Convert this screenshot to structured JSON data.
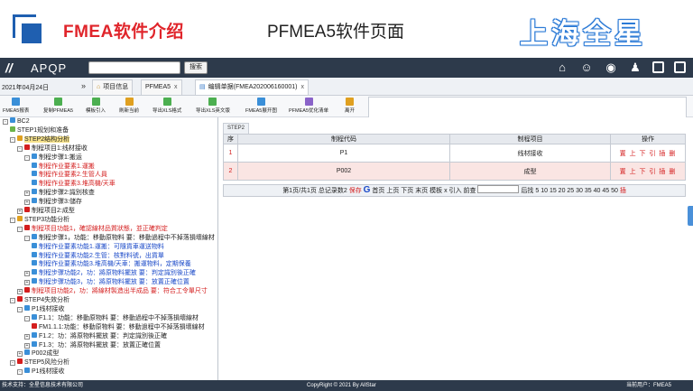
{
  "slide": {
    "title": "FMEA软件介绍",
    "subtitle": "PFMEA5软件页面",
    "brand": "上海全星"
  },
  "app": {
    "name": "APQP",
    "search_placeholder": "",
    "search_button": "搜索",
    "top_icons": [
      "home-icon",
      "users-icon",
      "globe-icon",
      "user-icon",
      "window-icon",
      "close-icon"
    ]
  },
  "tabs": {
    "date": "2021年04月24日",
    "items": [
      {
        "label": "项目信息",
        "closable": false
      },
      {
        "label": "PFMEA5",
        "closable": true
      },
      {
        "label": "编辑单据(FMEA202006160001)",
        "closable": true
      }
    ]
  },
  "toolbar": {
    "items": [
      {
        "label": "FMEA5报表",
        "color": "#3a8fd8"
      },
      {
        "label": "复制PFMEA5",
        "color": "#4caf50"
      },
      {
        "label": "模板引入",
        "color": "#4caf50"
      },
      {
        "label": "刷新当前",
        "color": "#e0a020"
      },
      {
        "label": "导出XLS格式",
        "color": "#4caf50"
      },
      {
        "label": "导出XLS英文版",
        "color": "#4caf50"
      },
      {
        "label": "FMEA5展开图",
        "color": "#3a8fd8"
      },
      {
        "label": "PFMEA5优化清单",
        "color": "#8a63c9"
      },
      {
        "label": "离开",
        "color": "#e0a020"
      }
    ]
  },
  "tree": {
    "nodes": [
      {
        "text": "BC2",
        "level": 0,
        "color": "dark",
        "exp": "-",
        "icon": "#3a8fd8"
      },
      {
        "text": "STEP1规划和准备",
        "level": 1,
        "color": "dark",
        "exp": "",
        "icon": "#6bb34a"
      },
      {
        "text": "STEP2结构分析",
        "level": 1,
        "color": "dark",
        "exp": "-",
        "icon": "#e0a020",
        "highlight": true
      },
      {
        "text": "制程项目1:线材接收",
        "level": 2,
        "color": "dark",
        "exp": "-",
        "icon": "#d41e1e"
      },
      {
        "text": "制程步骤1:搬运",
        "level": 3,
        "color": "dark",
        "exp": "-",
        "icon": "#3a8fd8"
      },
      {
        "text": "制程作业要素1.運搬",
        "level": 4,
        "color": "red",
        "exp": "",
        "icon": "#3a8fd8"
      },
      {
        "text": "制程作业要素2.生管人員",
        "level": 4,
        "color": "red",
        "exp": "",
        "icon": "#3a8fd8"
      },
      {
        "text": "制程作业要素3.堆高機/天車",
        "level": 4,
        "color": "red",
        "exp": "",
        "icon": "#3a8fd8"
      },
      {
        "text": "制程步骤2:識別核查",
        "level": 3,
        "color": "dark",
        "exp": "+",
        "icon": "#3a8fd8"
      },
      {
        "text": "制程步骤3:儲存",
        "level": 3,
        "color": "dark",
        "exp": "+",
        "icon": "#3a8fd8"
      },
      {
        "text": "制程项目2:成型",
        "level": 2,
        "color": "dark",
        "exp": "+",
        "icon": "#d41e1e"
      },
      {
        "text": "STEP3功能分析",
        "level": 1,
        "color": "dark",
        "exp": "-",
        "icon": "#e0a020"
      },
      {
        "text": "制程项目功能1，確認線材品質狀態，並正確判定",
        "level": 2,
        "color": "red",
        "exp": "-",
        "icon": "#d41e1e"
      },
      {
        "text": "制程步骤1，功能：移動原物料 要：移動過程中不掉落損壞線材",
        "level": 3,
        "color": "dark",
        "exp": "-",
        "icon": "#3a8fd8"
      },
      {
        "text": "制程作业要素功能1.運搬：可隨貨車運送物料",
        "level": 4,
        "color": "blue",
        "exp": "",
        "icon": "#3a8fd8"
      },
      {
        "text": "制程作业要素功能2.生管：核對料號，出貨單",
        "level": 4,
        "color": "blue",
        "exp": "",
        "icon": "#3a8fd8"
      },
      {
        "text": "制程作业要素功能3.堆高機/天車：搬運物料，定期保養",
        "level": 4,
        "color": "blue",
        "exp": "",
        "icon": "#3a8fd8"
      },
      {
        "text": "制程步骤功能2，功：將原物料擺放 要：判定識別後正確",
        "level": 3,
        "color": "blue",
        "exp": "+",
        "icon": "#3a8fd8"
      },
      {
        "text": "制程步骤功能3，功：將原物料擺放 要：放置正確位置",
        "level": 3,
        "color": "blue",
        "exp": "+",
        "icon": "#3a8fd8"
      },
      {
        "text": "制程项目功能2，功：將線材製造出半成品 要：符合工令單尺寸",
        "level": 2,
        "color": "red",
        "exp": "+",
        "icon": "#d41e1e"
      },
      {
        "text": "STEP4失效分析",
        "level": 1,
        "color": "dark",
        "exp": "-",
        "icon": "#d41e1e"
      },
      {
        "text": "P1线材接收",
        "level": 2,
        "color": "dark",
        "exp": "-",
        "icon": "#3a8fd8"
      },
      {
        "text": "F1.1：功能：移動原物料 要：移動過程中不掉落損壞線材",
        "level": 3,
        "color": "dark",
        "exp": "-",
        "icon": "#3a8fd8"
      },
      {
        "text": "FM1.1.1:功能：移動原物料 要：移動過程中不掉落損壞線材",
        "level": 4,
        "color": "dark",
        "exp": "",
        "icon": "#d41e1e"
      },
      {
        "text": "F1.2：功：將原物料擺放 要：判定識別後正確",
        "level": 3,
        "color": "dark",
        "exp": "+",
        "icon": "#3a8fd8"
      },
      {
        "text": "F1.3：功：將原物料擺放 要：放置正確位置",
        "level": 3,
        "color": "dark",
        "exp": "+",
        "icon": "#3a8fd8"
      },
      {
        "text": "P002成型",
        "level": 2,
        "color": "dark",
        "exp": "+",
        "icon": "#3a8fd8"
      },
      {
        "text": "STEP5风险分析",
        "level": 1,
        "color": "dark",
        "exp": "-",
        "icon": "#d41e1e"
      },
      {
        "text": "P1线材接收",
        "level": 2,
        "color": "dark",
        "exp": "-",
        "icon": "#3a8fd8"
      }
    ]
  },
  "content": {
    "step_tab": "STEP2",
    "headers": [
      "序",
      "制程代码",
      "制程项目",
      "操作"
    ],
    "rows": [
      {
        "seq": "1",
        "code": "P1",
        "item": "线材接收",
        "ops": "置 上 下 引 插 删"
      },
      {
        "seq": "2",
        "code": "P002",
        "item": "成型",
        "ops": "置 上 下 引 插 删"
      }
    ],
    "pager": {
      "info": "第1页/共1页 总记录数2",
      "save": "保存",
      "go": "G",
      "nav": "首页 上页 下页 末页 模板 x 引入 前查",
      "sizes_label": "后找 5 10 15 20 25 30 35 40 45 50",
      "insert": "插"
    }
  },
  "status": {
    "left": "技术支持：全星信息技术有限公司",
    "center": "CopyRight © 2021 By AllStar",
    "right_label": "当前用户：",
    "right_user": "FMEA5"
  }
}
